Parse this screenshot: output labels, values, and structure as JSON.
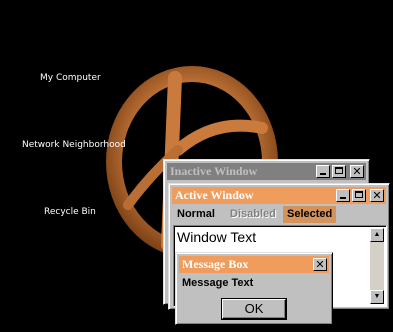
{
  "desktop": {
    "icons": [
      {
        "label": "My Computer"
      },
      {
        "label": "Network Neighborhood"
      },
      {
        "label": "Recycle Bin"
      }
    ],
    "background_color": "#000000",
    "logo_color": "#d08a4a"
  },
  "inactive_window": {
    "title": "Inactive Window",
    "title_bg": "#808080",
    "title_fg": "#c0c0c0"
  },
  "active_window": {
    "title": "Active Window",
    "title_bg": "#ef9c5c",
    "title_fg": "#ffffff",
    "menu": [
      {
        "label": "Normal",
        "state": "normal"
      },
      {
        "label": "Disabled",
        "state": "disabled"
      },
      {
        "label": "Selected",
        "state": "selected"
      }
    ],
    "window_text": "Window Text",
    "selected_bg": "#d4935a"
  },
  "message_box": {
    "title": "Message Box",
    "title_bg": "#ef9c5c",
    "text": "Message Text",
    "ok_label": "OK"
  },
  "icons": {
    "minimize": "minimize-icon",
    "maximize": "maximize-icon",
    "close": "close-icon",
    "scroll_up": "scroll-up-arrow-icon",
    "scroll_down": "scroll-down-arrow-icon"
  }
}
